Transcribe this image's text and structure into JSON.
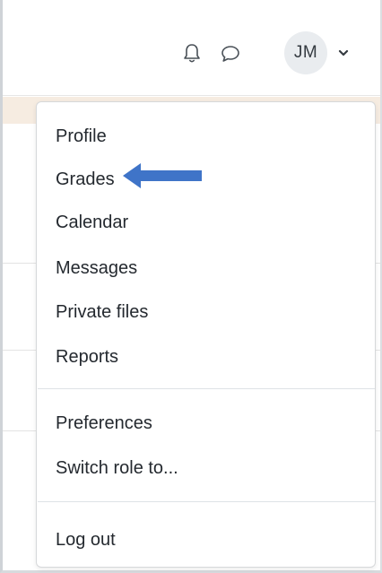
{
  "header": {
    "avatar_initials": "JM",
    "icons": [
      "bell-icon",
      "chat-icon",
      "chevron-down-icon"
    ]
  },
  "user_menu": {
    "items": [
      {
        "label": "Profile"
      },
      {
        "label": "Grades"
      },
      {
        "label": "Calendar"
      },
      {
        "label": "Messages"
      },
      {
        "label": "Private files"
      },
      {
        "label": "Reports"
      },
      {
        "label": "Preferences"
      },
      {
        "label": "Switch role to..."
      },
      {
        "label": "Log out"
      }
    ]
  },
  "annotation": {
    "arrow_color": "#3f74c8",
    "points_to": "Grades"
  },
  "colors": {
    "band": "#f6ece1",
    "avatar_bg": "#e9ecef"
  }
}
